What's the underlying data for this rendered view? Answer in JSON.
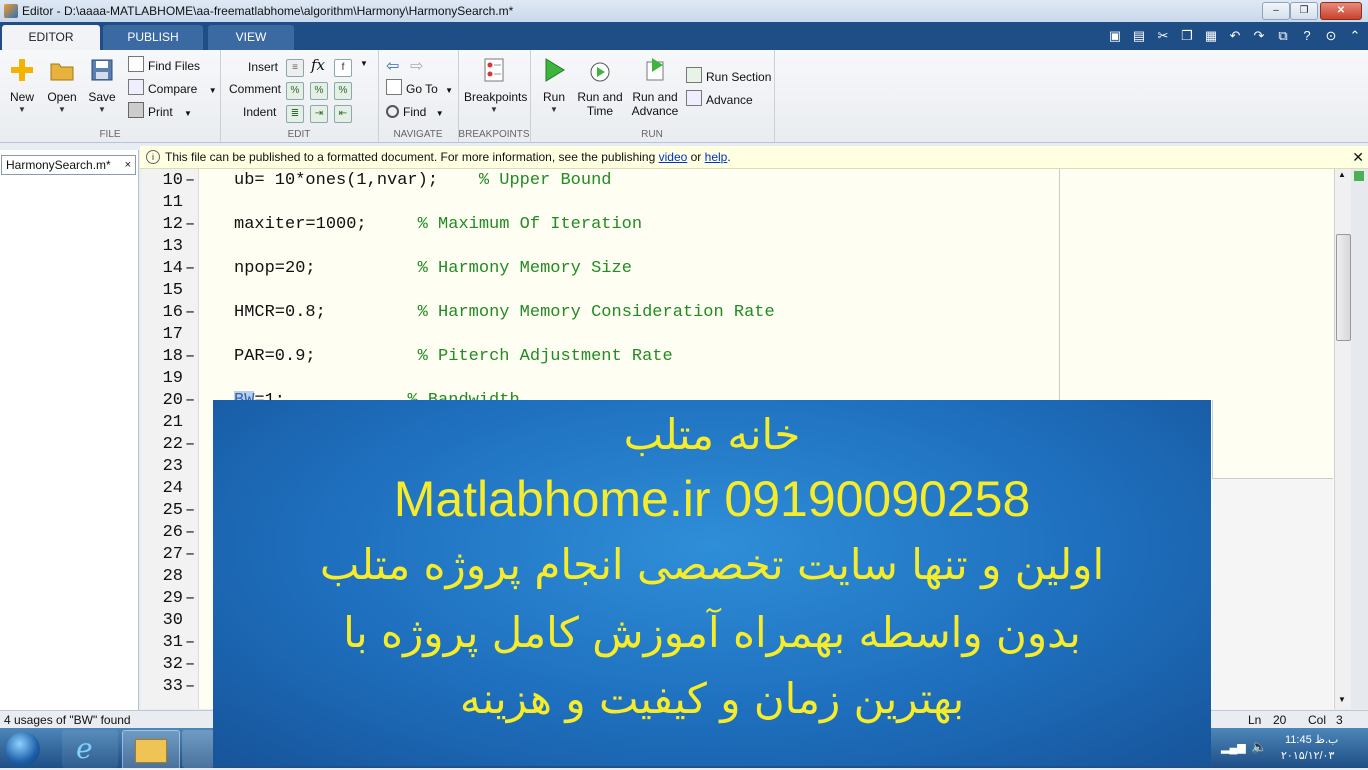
{
  "window": {
    "title": "Editor - D:\\aaaa-MATLABHOME\\aa-freematlabhome\\algorithm\\Harmony\\HarmonySearch.m*",
    "controls": {
      "minimize": "‒",
      "maximize": "❐",
      "close": "✕"
    }
  },
  "tabs": [
    {
      "label": "EDITOR",
      "active": true
    },
    {
      "label": "PUBLISH",
      "active": false
    },
    {
      "label": "VIEW",
      "active": false
    }
  ],
  "ribbon": {
    "file": {
      "label": "FILE",
      "new": "New",
      "open": "Open",
      "save": "Save",
      "find_files": "Find Files",
      "compare": "Compare",
      "print": "Print"
    },
    "edit": {
      "label": "EDIT",
      "insert": "Insert",
      "comment": "Comment",
      "indent": "Indent",
      "fx": "fx"
    },
    "navigate": {
      "label": "NAVIGATE",
      "goto": "Go To",
      "find": "Find"
    },
    "breakpoints": {
      "label": "BREAKPOINTS",
      "breakpoints": "Breakpoints"
    },
    "run": {
      "label": "RUN",
      "run": "Run",
      "run_and_time_1": "Run and",
      "run_and_time_2": "Time",
      "run_and_advance_1": "Run and",
      "run_and_advance_2": "Advance",
      "run_section": "Run Section",
      "advance": "Advance"
    }
  },
  "file_tab": {
    "name": "HarmonySearch.m*",
    "close": "×"
  },
  "notice": {
    "text": "This file can be published to a formatted document. For more information, see the publishing ",
    "link1": "video",
    "or": " or ",
    "link2": "help",
    "end": ".",
    "close": "✕"
  },
  "code_lines": [
    {
      "n": "10",
      "dash": "–",
      "code": "ub= 10*ones(1,nvar);",
      "pad": "    ",
      "comment": "% Upper Bound"
    },
    {
      "n": "11",
      "dash": "",
      "code": "",
      "pad": "",
      "comment": ""
    },
    {
      "n": "12",
      "dash": "–",
      "code": "maxiter=1000;",
      "pad": "     ",
      "comment": "% Maximum Of Iteration"
    },
    {
      "n": "13",
      "dash": "",
      "code": "",
      "pad": "",
      "comment": ""
    },
    {
      "n": "14",
      "dash": "–",
      "code": "npop=20;",
      "pad": "          ",
      "comment": "% Harmony Memory Size"
    },
    {
      "n": "15",
      "dash": "",
      "code": "",
      "pad": "",
      "comment": ""
    },
    {
      "n": "16",
      "dash": "–",
      "code": "HMCR=0.8;",
      "pad": "         ",
      "comment": "% Harmony Memory Consideration Rate"
    },
    {
      "n": "17",
      "dash": "",
      "code": "",
      "pad": "",
      "comment": ""
    },
    {
      "n": "18",
      "dash": "–",
      "code": "PAR=0.9;",
      "pad": "          ",
      "comment": "% Piterch Adjustment Rate"
    },
    {
      "n": "19",
      "dash": "",
      "code": "",
      "pad": "",
      "comment": ""
    },
    {
      "n": "20",
      "dash": "–",
      "code": "BW=1;",
      "pad": "            ",
      "comment": "% Bandwidth"
    },
    {
      "n": "21",
      "dash": "",
      "code": "",
      "pad": "",
      "comment": ""
    },
    {
      "n": "22",
      "dash": "–",
      "code": "",
      "pad": "",
      "comment": ""
    },
    {
      "n": "23",
      "dash": "",
      "code": "",
      "pad": "",
      "comment": ""
    },
    {
      "n": "24",
      "dash": "",
      "code": "",
      "pad": "",
      "comment": ""
    },
    {
      "n": "25",
      "dash": "–",
      "code": "",
      "pad": "",
      "comment": ""
    },
    {
      "n": "26",
      "dash": "–",
      "code": "",
      "pad": "",
      "comment": ""
    },
    {
      "n": "27",
      "dash": "–",
      "code": "",
      "pad": "",
      "comment": ""
    },
    {
      "n": "28",
      "dash": "",
      "code": "",
      "pad": "",
      "comment": ""
    },
    {
      "n": "29",
      "dash": "–",
      "code": "",
      "pad": "",
      "comment": ""
    },
    {
      "n": "30",
      "dash": "",
      "code": "",
      "pad": "",
      "comment": ""
    },
    {
      "n": "31",
      "dash": "–",
      "code": "",
      "pad": "",
      "comment": ""
    },
    {
      "n": "32",
      "dash": "–",
      "code": "",
      "pad": "",
      "comment": ""
    },
    {
      "n": "33",
      "dash": "–",
      "code": "",
      "pad": "",
      "comment": ""
    }
  ],
  "status": {
    "left": "4 usages of \"BW\" found",
    "ln_label": "Ln",
    "ln": "20",
    "col_label": "Col",
    "col": "3"
  },
  "banner": {
    "line1": "خانه متلب",
    "line2": "Matlabhome.ir 09190090258",
    "line3": "اولین و تنها سایت تخصصی انجام پروژه متلب",
    "line4": "بدون واسطه بهمراه آموزش کامل پروژه با",
    "line5": "بهترین زمان و کیفیت و هزینه"
  },
  "tray": {
    "time": "11:45 ب.ظ",
    "date": "۲۰۱۵/۱۲/۰۳"
  },
  "colors": {
    "ribbon_tab": "#1f4e86",
    "comment": "#228b22",
    "banner_text": "#f6ec2a",
    "banner_bg": "#1e6fbe"
  }
}
